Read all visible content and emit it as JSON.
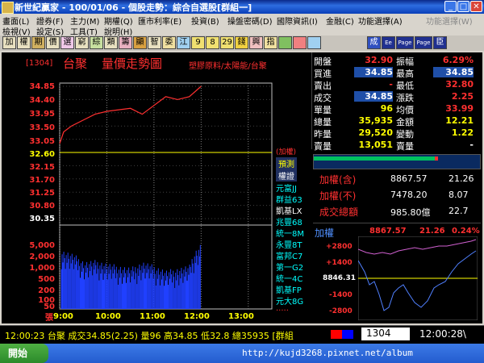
{
  "window": {
    "title": "新世紀贏家 - 100/01/06 - 個股走勢：綜合自選股[群組一]"
  },
  "menus_row1": [
    "畫面(L)",
    "證券(F)",
    "主力(M)",
    "期權(Q)",
    "匯市利率(E)",
    "投資(B)",
    "操盤密碼(D)",
    "國際資訊(I)",
    "金融(C)",
    "功能選擇(A)",
    "功能選擇(W)"
  ],
  "menus_row2": [
    "檢視(V)",
    "設定(S)",
    "工具(T)",
    "說明(H)"
  ],
  "toolbar": [
    "加",
    "權",
    "期",
    "價",
    "選",
    "窮",
    "綜",
    "類",
    "籌",
    "顯",
    "智",
    "委",
    "江",
    "9",
    "8",
    "29",
    "錢",
    "興",
    "指",
    "",
    "",
    "",
    "成",
    "Ee",
    "Page",
    "Page",
    "臣"
  ],
  "chart": {
    "code": "[1304]",
    "name": "台聚",
    "title": "量價走勢圖",
    "category": "塑膠原料/太陽能/台聚",
    "price_labels": [
      "34.85",
      "34.40",
      "33.95",
      "33.50",
      "33.05",
      "32.60",
      "32.15",
      "31.70",
      "31.25",
      "30.80",
      "30.35"
    ],
    "volume_labels": [
      "5,000",
      "2,000",
      "1,000",
      "500",
      "200",
      "100",
      "50",
      "張"
    ],
    "time_labels": [
      "9:00",
      "10:00",
      "11:00",
      "12:00",
      "13:00"
    ],
    "side_top": "(加權)",
    "side_tab1": "預測",
    "side_tab2": "權證",
    "warrants": [
      "元富JJ",
      "群益63",
      "凱基LX",
      "兆豐68",
      "統一8M",
      "永豐8T",
      "富邦C7",
      "第一G2",
      "統一4C",
      "凱基FP",
      "元大8G",
      "....."
    ]
  },
  "chart_data": {
    "type": "line",
    "title": "量價走勢圖",
    "x_ticks": [
      "9:00",
      "10:00",
      "11:00",
      "12:00",
      "13:00"
    ],
    "price_ylim": [
      30.35,
      34.85
    ],
    "reference_price": 32.6,
    "price_series": [
      {
        "t": "9:00",
        "v": 32.9
      },
      {
        "t": "9:05",
        "v": 33.3
      },
      {
        "t": "9:15",
        "v": 33.5
      },
      {
        "t": "9:30",
        "v": 33.7
      },
      {
        "t": "9:45",
        "v": 33.9
      },
      {
        "t": "10:00",
        "v": 34.0
      },
      {
        "t": "10:30",
        "v": 34.1
      },
      {
        "t": "10:45",
        "v": 33.9
      },
      {
        "t": "11:00",
        "v": 34.2
      },
      {
        "t": "11:15",
        "v": 34.5
      },
      {
        "t": "11:30",
        "v": 34.4
      },
      {
        "t": "11:45",
        "v": 34.5
      },
      {
        "t": "12:00",
        "v": 34.85
      }
    ],
    "volume_levels": [
      2000,
      1500,
      900,
      1000,
      800,
      700,
      600,
      900,
      700,
      500,
      600,
      700,
      3000
    ]
  },
  "quote": {
    "rows": [
      [
        "開盤",
        "32.90",
        "振幅",
        "6.29%"
      ],
      [
        "買進",
        "34.85",
        "最高",
        "34.85"
      ],
      [
        "賣出",
        "-",
        "最低",
        "32.80"
      ],
      [
        "成交",
        "34.85",
        "漲跌",
        "2.25"
      ],
      [
        "單量",
        "96",
        "均價",
        "33.99"
      ],
      [
        "總量",
        "35,935",
        "金額",
        "12.21"
      ],
      [
        "昨量",
        "29,520",
        "變動",
        "1.22"
      ],
      [
        "賣量",
        "13,051",
        "賣量",
        "-"
      ]
    ],
    "index": [
      [
        "加權(含)",
        "8867.57",
        "21.26"
      ],
      [
        "加權(不)",
        "7478.20",
        "8.07"
      ],
      [
        "成交總額",
        "985.80億",
        "22.7"
      ]
    ],
    "mini": {
      "label": "加權",
      "value": "8867.57",
      "change": "21.26",
      "pct": "0.24%",
      "levels": [
        "+2800",
        "+1400",
        "8846.31",
        "-1400",
        "-2800"
      ]
    }
  },
  "status": {
    "text": "12:00:23 台聚 成交34.85(2.25) 量96 高34.85 低32.8 總35935 [群組",
    "code": "1304",
    "time": "12:00:28\\"
  },
  "taskbar": {
    "start": "開始",
    "watermark": "http://kujd3268.pixnet.net/album"
  }
}
